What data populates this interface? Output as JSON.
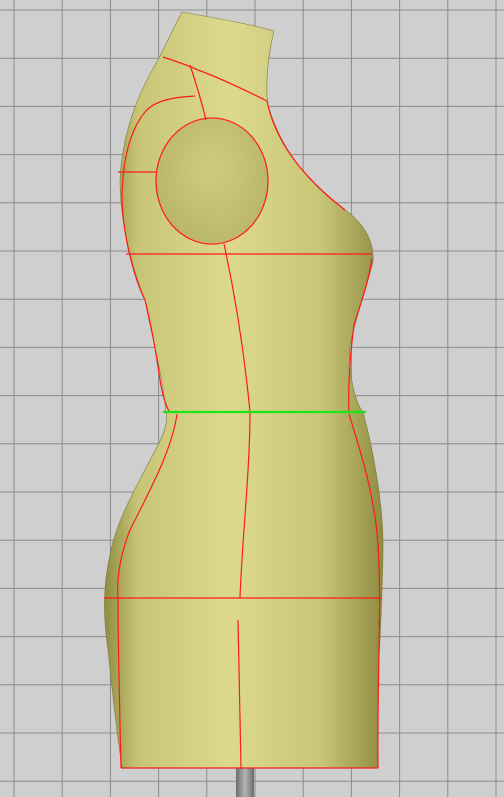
{
  "viewport": {
    "background_color": "#cfcfcf",
    "grid_color": "#8c8c8c",
    "grid_visible": true
  },
  "mannequin": {
    "view": "side",
    "body_color": "#c9c576",
    "body_highlight_color": "#dcd98e",
    "body_shadow_color": "#8f8b42",
    "seam_color": "#ff1a1a",
    "waist_line_color": "#19e619",
    "stand_color": "#8a8a8a",
    "waist_line_selected": true
  }
}
